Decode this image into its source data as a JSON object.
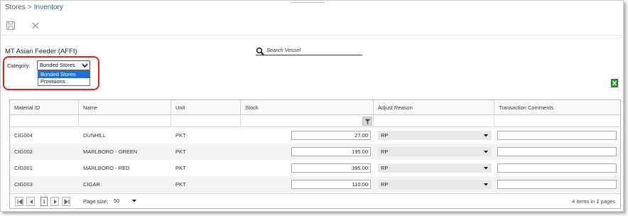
{
  "breadcrumb": {
    "parent": "Stores",
    "separator": ">",
    "current": "Inventory"
  },
  "toolbar": {
    "save_icon": "save-icon",
    "close_icon": "close-icon"
  },
  "vessel": {
    "title": "MT Asian Feeder (AFFI)"
  },
  "search": {
    "placeholder": "Search Vessel",
    "value": ""
  },
  "category": {
    "label": "Category:",
    "selected": "Bonded Stores",
    "options": [
      "Bonded Stores",
      "Provisions"
    ],
    "highlight_color": "#e02020"
  },
  "grid": {
    "columns": [
      "Material ID",
      "Name",
      "Unit",
      "Stock",
      "Adjust Reason",
      "Transaction Comments"
    ],
    "rows": [
      {
        "material_id": "CIG004",
        "name": "DUNHILL",
        "unit": "PKT",
        "stock": "27.00",
        "reason": "RP",
        "comment": ""
      },
      {
        "material_id": "CIG002",
        "name": "MARLBORO - GREEN",
        "unit": "PKT",
        "stock": "195.00",
        "reason": "RP",
        "comment": ""
      },
      {
        "material_id": "CIG001",
        "name": "MARLBORO - RED",
        "unit": "PKT",
        "stock": "395.00",
        "reason": "RP",
        "comment": ""
      },
      {
        "material_id": "CIG003",
        "name": "CIGAR",
        "unit": "PKT",
        "stock": "110.00",
        "reason": "RP",
        "comment": ""
      }
    ]
  },
  "pager": {
    "current_page": "1",
    "page_size_label": "Page size:",
    "page_size": "50",
    "info": "4 items in 1 pages"
  },
  "colors": {
    "accent": "#2a5fa8",
    "selection": "#1e6fd6"
  }
}
